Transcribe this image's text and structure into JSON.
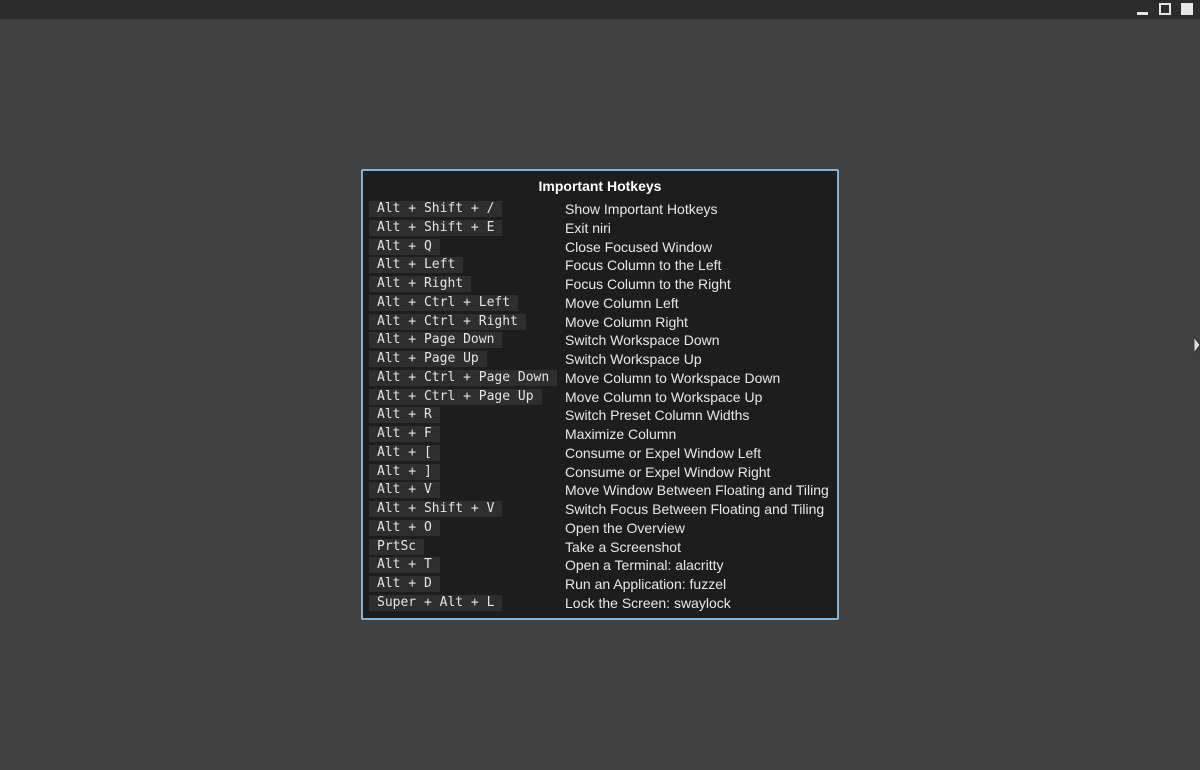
{
  "overlay": {
    "title": "Important Hotkeys",
    "hotkeys": [
      {
        "keys": "Alt + Shift + /",
        "action": "Show Important Hotkeys"
      },
      {
        "keys": "Alt + Shift + E",
        "action": "Exit niri"
      },
      {
        "keys": "Alt + Q",
        "action": "Close Focused Window"
      },
      {
        "keys": "Alt + Left",
        "action": "Focus Column to the Left"
      },
      {
        "keys": "Alt + Right",
        "action": "Focus Column to the Right"
      },
      {
        "keys": "Alt + Ctrl + Left",
        "action": "Move Column Left"
      },
      {
        "keys": "Alt + Ctrl + Right",
        "action": "Move Column Right"
      },
      {
        "keys": "Alt + Page Down",
        "action": "Switch Workspace Down"
      },
      {
        "keys": "Alt + Page Up",
        "action": "Switch Workspace Up"
      },
      {
        "keys": "Alt + Ctrl + Page Down",
        "action": "Move Column to Workspace Down"
      },
      {
        "keys": "Alt + Ctrl + Page Up",
        "action": "Move Column to Workspace Up"
      },
      {
        "keys": "Alt + R",
        "action": "Switch Preset Column Widths"
      },
      {
        "keys": "Alt + F",
        "action": "Maximize Column"
      },
      {
        "keys": "Alt + [",
        "action": "Consume or Expel Window Left"
      },
      {
        "keys": "Alt + ]",
        "action": "Consume or Expel Window Right"
      },
      {
        "keys": "Alt + V",
        "action": "Move Window Between Floating and Tiling"
      },
      {
        "keys": "Alt + Shift + V",
        "action": "Switch Focus Between Floating and Tiling"
      },
      {
        "keys": "Alt + O",
        "action": "Open the Overview"
      },
      {
        "keys": "PrtSc",
        "action": "Take a Screenshot"
      },
      {
        "keys": "Alt + T",
        "action": "Open a Terminal: alacritty"
      },
      {
        "keys": "Alt + D",
        "action": "Run an Application: fuzzel"
      },
      {
        "keys": "Super + Alt + L",
        "action": "Lock the Screen: swaylock"
      }
    ]
  },
  "window_controls": {
    "minimize_icon": "minimize-icon",
    "maximize_icon": "maximize-icon",
    "close_icon": "close-icon"
  },
  "colors": {
    "desktop_background": "#404040",
    "titlebar": "#2c2c2c",
    "overlay_background": "#1d1d1d",
    "overlay_border": "#7fb4e0",
    "key_background": "#2e2e2e"
  }
}
